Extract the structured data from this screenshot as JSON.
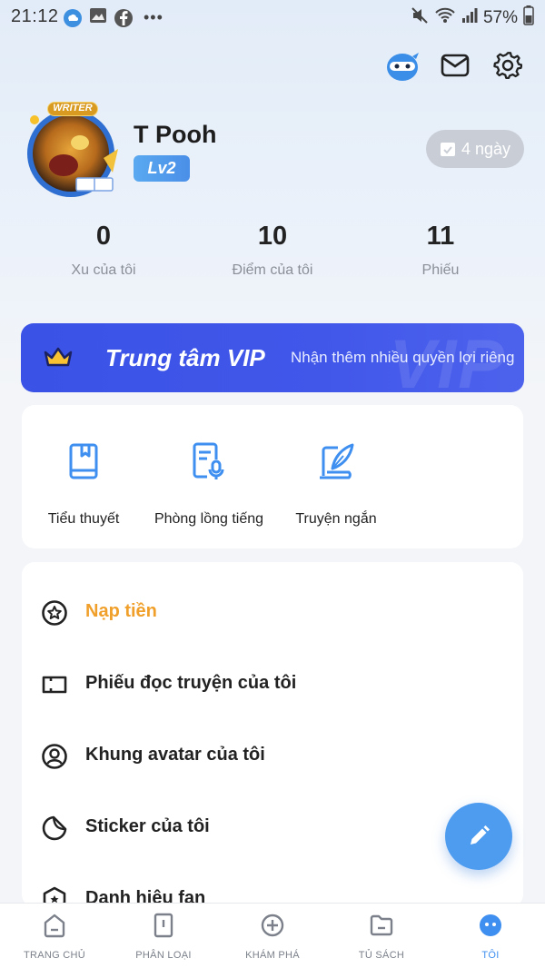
{
  "status_bar": {
    "time": "21:12",
    "dots": "•••",
    "battery": "57%"
  },
  "header": {
    "icons": [
      "ninja-mascot-icon",
      "mail-icon",
      "settings-gear-icon"
    ]
  },
  "profile": {
    "avatar_badge": "WRITER",
    "username": "T Pooh",
    "level": "Lv2",
    "checkin_label": "4 ngày"
  },
  "stats": [
    {
      "value": "0",
      "label": "Xu của tôi"
    },
    {
      "value": "10",
      "label": "Điểm của tôi"
    },
    {
      "value": "11",
      "label": "Phiếu"
    }
  ],
  "vip": {
    "title": "Trung tâm VIP",
    "subtitle": "Nhận thêm nhiều quyền lợi riêng",
    "watermark": "VIP",
    "accent": "#3f55e8"
  },
  "quick_links": [
    {
      "label": "Tiểu thuyết",
      "icon": "novel-book-icon"
    },
    {
      "label": "Phòng lồng tiếng",
      "icon": "voice-room-icon"
    },
    {
      "label": "Truyện ngắn",
      "icon": "short-story-icon"
    }
  ],
  "menu": [
    {
      "label": "Nạp tiền",
      "icon": "coin-star-icon",
      "highlight": true
    },
    {
      "label": "Phiếu đọc truyện của tôi",
      "icon": "ticket-icon"
    },
    {
      "label": "Khung avatar của tôi",
      "icon": "avatar-frame-icon"
    },
    {
      "label": "Sticker của tôi",
      "icon": "sticker-icon"
    },
    {
      "label": "Danh hiệu fan",
      "icon": "fan-badge-icon"
    }
  ],
  "fab": {
    "icon": "pencil-icon"
  },
  "bottom_nav": [
    {
      "label": "TRANG CHỦ",
      "icon": "home-icon",
      "active": false
    },
    {
      "label": "PHÂN LOẠI",
      "icon": "category-icon",
      "active": false
    },
    {
      "label": "KHÁM PHÁ",
      "icon": "explore-plus-icon",
      "active": false
    },
    {
      "label": "TỦ SÁCH",
      "icon": "bookshelf-folder-icon",
      "active": false
    },
    {
      "label": "TÔI",
      "icon": "me-face-icon",
      "active": true
    }
  ],
  "colors": {
    "primary": "#3e8ff0",
    "vip_blue": "#3f55e8",
    "highlight_orange": "#f0a02a",
    "muted_text": "#8a8f98"
  }
}
